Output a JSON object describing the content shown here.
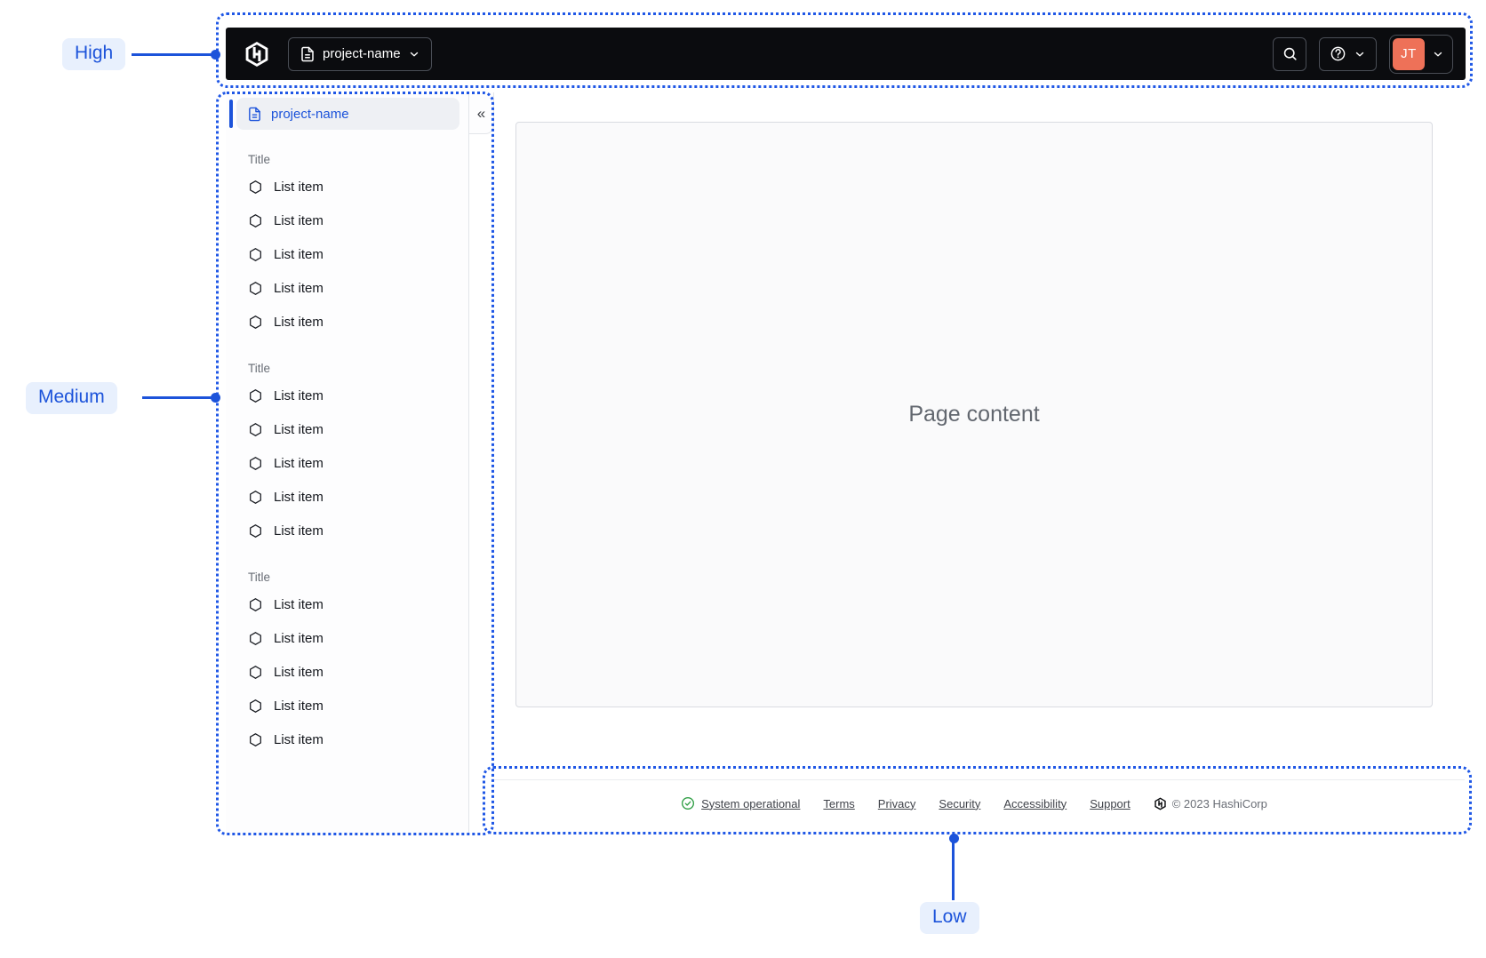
{
  "annotations": {
    "high": "High",
    "medium": "Medium",
    "low": "Low"
  },
  "navbar": {
    "logo_icon": "hashicorp-logo",
    "project_switcher": {
      "icon": "file-text-icon",
      "label": "project-name",
      "chevron": "chevron-down-icon"
    },
    "search_icon": "search-icon",
    "help_icon": "help-icon",
    "user_menu": {
      "initials": "JT",
      "chevron": "chevron-down-icon"
    }
  },
  "sidebar": {
    "active_item": {
      "icon": "file-text-icon",
      "label": "project-name"
    },
    "collapse_glyph": "«",
    "sections": [
      {
        "title": "Title",
        "items": [
          "List item",
          "List item",
          "List item",
          "List item",
          "List item"
        ]
      },
      {
        "title": "Title",
        "items": [
          "List item",
          "List item",
          "List item",
          "List item",
          "List item"
        ]
      },
      {
        "title": "Title",
        "items": [
          "List item",
          "List item",
          "List item",
          "List item",
          "List item"
        ]
      }
    ]
  },
  "main": {
    "placeholder": "Page content"
  },
  "footer": {
    "status": "System operational",
    "links": [
      "Terms",
      "Privacy",
      "Security",
      "Accessibility",
      "Support"
    ],
    "copyright": "© 2023 HashiCorp"
  },
  "colors": {
    "annotation_blue": "#1c53da",
    "annotation_pill_bg": "#e8f0fd",
    "navbar_bg": "#0b0c0f",
    "avatar_orange": "#ee7158",
    "active_item_blue": "#1c53da",
    "status_green": "#2f9e44"
  }
}
